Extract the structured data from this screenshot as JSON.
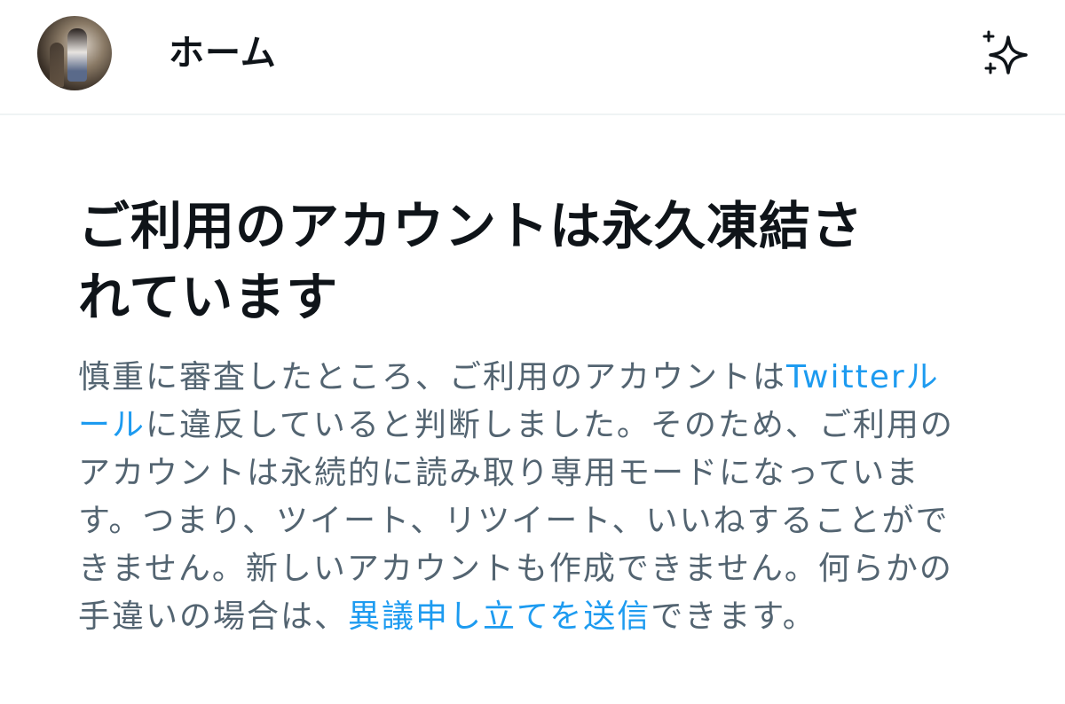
{
  "header": {
    "title": "ホーム",
    "avatar_label": "profile avatar",
    "sparkle_icon": "sparkle-icon"
  },
  "notice": {
    "headline_line1": "ご利用のアカウントは永久凍結さ",
    "headline_line2": "れています",
    "body_part1": "慎重に審査したところ、ご利用のアカウントは",
    "rules_link": "Twitterルール",
    "body_part2": "に違反していると判断しました。そのため、ご利用のアカウントは永続的に読み取り専用モードになっています。つまり、ツイート、リツイート、いいねすることができません。新しいアカウントも作成できません。何らかの手違いの場合は、",
    "appeal_link": "異議申し立てを送信",
    "body_part3": "できます。"
  },
  "colors": {
    "text_primary": "#0f1419",
    "text_secondary": "#536471",
    "link": "#1d9bf0"
  }
}
